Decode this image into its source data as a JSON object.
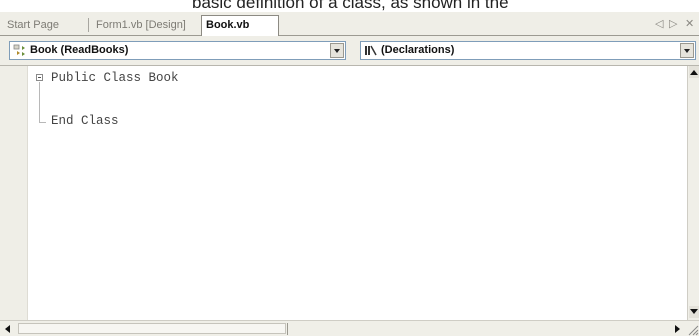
{
  "caption": "basic definition of a class, as shown in the",
  "tabs": [
    {
      "label": "Start Page",
      "active": false
    },
    {
      "label": "Form1.vb [Design]",
      "active": false
    },
    {
      "label": "Book.vb",
      "active": true
    }
  ],
  "tab_controls": {
    "prev": "◁",
    "next": "▷",
    "close": "✕"
  },
  "combos": {
    "class_selector": {
      "value": "Book (ReadBooks)",
      "icon": "class-icon"
    },
    "member_selector": {
      "value": "(Declarations)",
      "icon": "declarations-icon"
    }
  },
  "code": {
    "lines": [
      "Public Class Book",
      "",
      "End Class"
    ]
  },
  "icons": {
    "outline_collapse": "minus-box-icon",
    "scroll_up": "arrow-up-icon",
    "scroll_down": "arrow-down-icon",
    "scroll_left": "arrow-left-icon",
    "scroll_right": "arrow-right-icon"
  },
  "colors": {
    "chrome": "#efeee7",
    "combo_border": "#7f9db9",
    "code_text": "#444444"
  }
}
